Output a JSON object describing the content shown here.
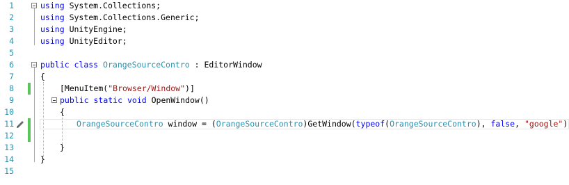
{
  "editor": {
    "lines": [
      {
        "num": "1"
      },
      {
        "num": "2"
      },
      {
        "num": "3"
      },
      {
        "num": "4"
      },
      {
        "num": "5"
      },
      {
        "num": "6"
      },
      {
        "num": "7"
      },
      {
        "num": "8"
      },
      {
        "num": "9"
      },
      {
        "num": "10"
      },
      {
        "num": "11"
      },
      {
        "num": "12"
      },
      {
        "num": "13"
      },
      {
        "num": "14"
      },
      {
        "num": "15"
      }
    ],
    "tokens": {
      "using": "using",
      "ns1": "System.Collections;",
      "ns2": "System.Collections.Generic;",
      "ns3": "UnityEngine;",
      "ns4": "UnityEditor;",
      "public": "public",
      "class": "class",
      "className": "OrangeSourceContro",
      "colon": " : ",
      "baseClass": "EditorWindow",
      "openBrace": "{",
      "closeBrace": "}",
      "attrOpen": "[MenuItem(",
      "attrString": "\"Browser/Window\"",
      "attrClose": ")]",
      "static": "static",
      "void": "void",
      "methodName": "OpenWindow()",
      "varType": "OrangeSourceContro",
      "assign": " window = (",
      "castType": "OrangeSourceContro",
      "getWindow": ")GetWindow(",
      "typeof": "typeof",
      "paren": "(",
      "typeofArg": "OrangeSourceContro",
      "argSep": "), ",
      "false": "false",
      "comma": ", ",
      "googleStr": "\"google\"",
      "end": ");"
    }
  },
  "colors": {
    "keyword": "#0000ff",
    "type": "#2b91af",
    "string": "#a31515",
    "lineNumber": "#2b91af",
    "changeBar": "#59c45b"
  }
}
